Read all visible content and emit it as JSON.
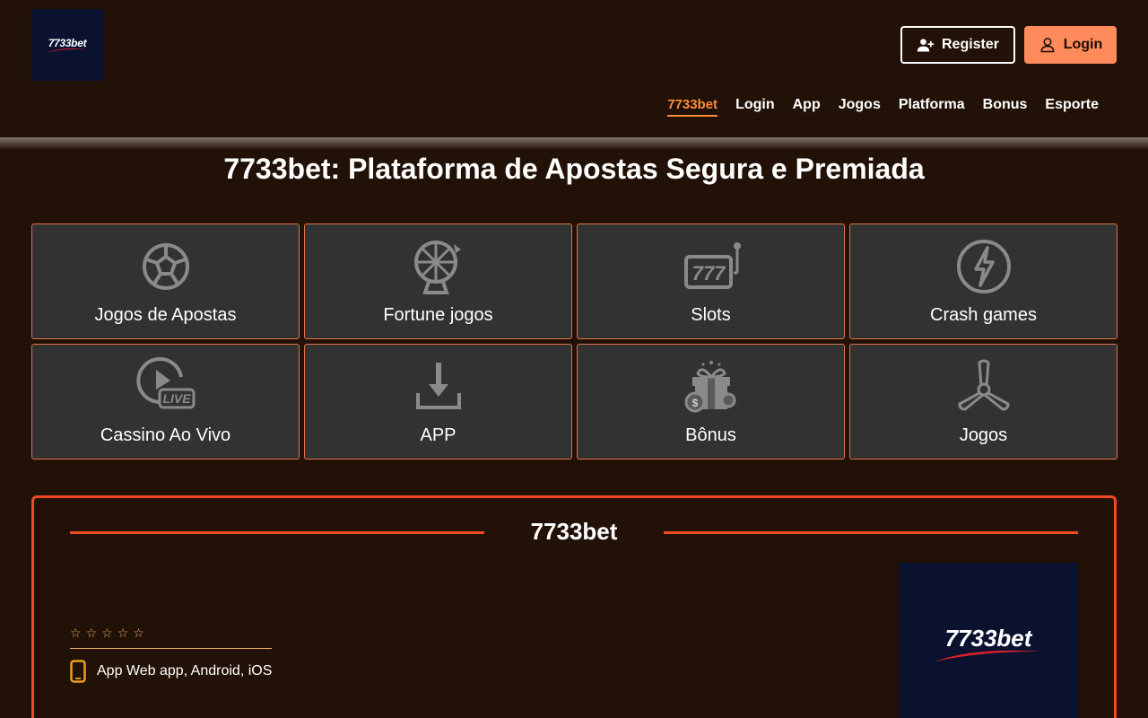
{
  "header": {
    "logo_text": "7733bet",
    "register_label": "Register",
    "login_label": "Login"
  },
  "nav": {
    "items": [
      {
        "label": "7733bet",
        "active": true
      },
      {
        "label": "Login"
      },
      {
        "label": "App"
      },
      {
        "label": "Jogos"
      },
      {
        "label": "Platforma"
      },
      {
        "label": "Bonus"
      },
      {
        "label": "Esporte"
      }
    ]
  },
  "page_title": "7733bet: Plataforma de Apostas Segura e Premiada",
  "categories": [
    {
      "label": "Jogos de Apostas",
      "icon": "soccer-ball-icon"
    },
    {
      "label": "Fortune jogos",
      "icon": "fortune-wheel-icon"
    },
    {
      "label": "Slots",
      "icon": "slot-machine-icon"
    },
    {
      "label": "Crash games",
      "icon": "lightning-icon"
    },
    {
      "label": "Cassino Ao Vivo",
      "icon": "live-play-icon"
    },
    {
      "label": "APP",
      "icon": "download-icon"
    },
    {
      "label": "Bônus",
      "icon": "gift-bonus-icon"
    },
    {
      "label": "Jogos",
      "icon": "propeller-icon"
    }
  ],
  "info": {
    "title": "7733bet",
    "rating_stars": 5,
    "rating_filled": 0,
    "app_platforms": "App Web app, Android, iOS",
    "logo_text": "7733bet"
  },
  "colors": {
    "background": "#221106",
    "accent_orange": "#ff8a5b",
    "border_red": "#ee4c1f",
    "card_bg": "#323232",
    "logo_bg": "#0a1230"
  }
}
